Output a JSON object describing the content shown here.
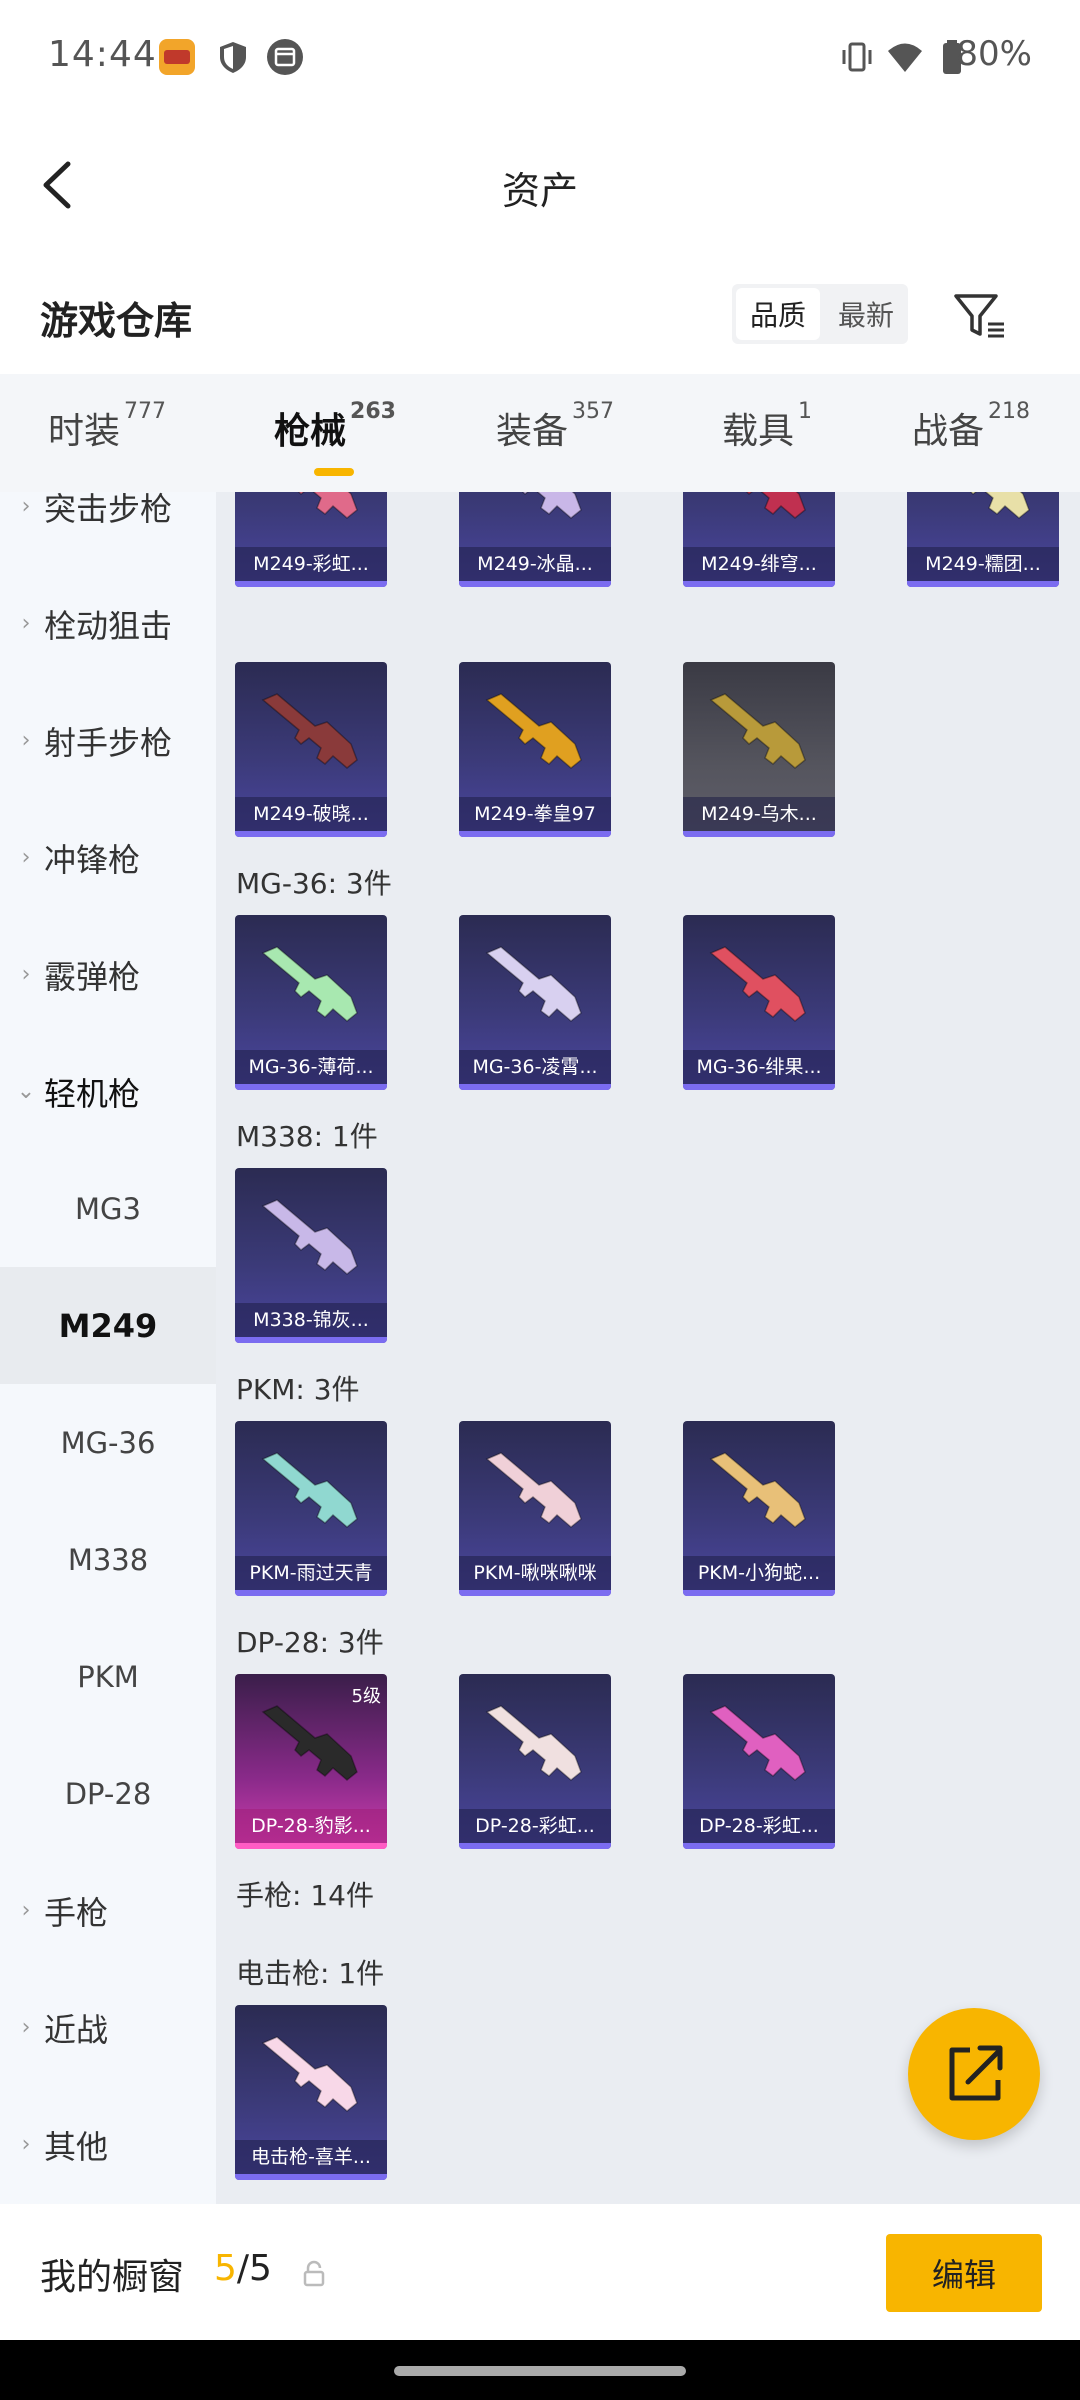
{
  "status_bar": {
    "time": "14:44",
    "battery": "80%",
    "icons": [
      "game-app-icon",
      "shield-icon",
      "calendar-icon",
      "vibrate-icon",
      "wifi-icon",
      "battery-icon"
    ]
  },
  "header": {
    "title": "资产"
  },
  "warehouse": {
    "title": "游戏仓库",
    "sort_options": [
      {
        "label": "品质",
        "active": true
      },
      {
        "label": "最新",
        "active": false
      }
    ]
  },
  "tabs": [
    {
      "label": "时装",
      "count": "777",
      "active": false
    },
    {
      "label": "枪械",
      "count": "263",
      "active": true
    },
    {
      "label": "装备",
      "count": "357",
      "active": false
    },
    {
      "label": "载具",
      "count": "1",
      "active": false
    },
    {
      "label": "战备",
      "count": "218",
      "active": false
    }
  ],
  "sidebar": {
    "items": [
      {
        "label": "突击步枪",
        "type": "category"
      },
      {
        "label": "栓动狙击",
        "type": "category"
      },
      {
        "label": "射手步枪",
        "type": "category"
      },
      {
        "label": "冲锋枪",
        "type": "category"
      },
      {
        "label": "霰弹枪",
        "type": "category"
      },
      {
        "label": "轻机枪",
        "type": "category-expanded"
      },
      {
        "label": "MG3",
        "type": "sub"
      },
      {
        "label": "M249",
        "type": "sub-active"
      },
      {
        "label": "MG-36",
        "type": "sub"
      },
      {
        "label": "M338",
        "type": "sub"
      },
      {
        "label": "PKM",
        "type": "sub"
      },
      {
        "label": "DP-28",
        "type": "sub"
      },
      {
        "label": "手枪",
        "type": "category"
      },
      {
        "label": "近战",
        "type": "category"
      },
      {
        "label": "其他",
        "type": "category"
      }
    ]
  },
  "content": {
    "groups": [
      {
        "label": "MG-36: 3件"
      },
      {
        "label": "M338: 1件"
      },
      {
        "label": "PKM: 3件"
      },
      {
        "label": "DP-28: 3件"
      },
      {
        "label": "手枪: 14件"
      },
      {
        "label": "电击枪: 1件"
      }
    ],
    "cards": [
      {
        "caption": "M249-彩虹...",
        "style": "purple",
        "gun_color": "#e06a8a"
      },
      {
        "caption": "M249-冰晶...",
        "style": "purple",
        "gun_color": "#c9b7e8"
      },
      {
        "caption": "M249-绯穹...",
        "style": "purple",
        "gun_color": "#c03050"
      },
      {
        "caption": "M249-糯团...",
        "style": "purple",
        "gun_color": "#e8e0a8"
      },
      {
        "caption": "M249-破晓...",
        "style": "purple",
        "gun_color": "#8a3a3a"
      },
      {
        "caption": "M249-拳皇97",
        "style": "purple",
        "gun_color": "#e0a020"
      },
      {
        "caption": "M249-乌木...",
        "style": "gray",
        "gun_color": "#b89a3a"
      },
      {
        "caption": "MG-36-薄荷...",
        "style": "purple",
        "gun_color": "#a8e8b0"
      },
      {
        "caption": "MG-36-凌霄...",
        "style": "purple",
        "gun_color": "#d8d0f0"
      },
      {
        "caption": "MG-36-绯果...",
        "style": "purple",
        "gun_color": "#e05060"
      },
      {
        "caption": "M338-锦灰...",
        "style": "purple",
        "gun_color": "#c8b8e8"
      },
      {
        "caption": "PKM-雨过天青",
        "style": "purple",
        "gun_color": "#90d8d0"
      },
      {
        "caption": "PKM-啾咪啾咪",
        "style": "purple",
        "gun_color": "#f0d0d8"
      },
      {
        "caption": "PKM-小狗蛇...",
        "style": "purple",
        "gun_color": "#e8c078"
      },
      {
        "caption": "DP-28-豹影...",
        "style": "pink",
        "gun_color": "#2a2a2a",
        "level": "5级"
      },
      {
        "caption": "DP-28-彩虹...",
        "style": "purple",
        "gun_color": "#f0e0e0"
      },
      {
        "caption": "DP-28-彩虹...",
        "style": "purple",
        "gun_color": "#e060c0"
      },
      {
        "caption": "电击枪-喜羊...",
        "style": "purple",
        "gun_color": "#f8d8e8"
      }
    ]
  },
  "fab": {
    "icon": "share-external-icon"
  },
  "bottom_bar": {
    "label": "我的橱窗",
    "count_current": "5",
    "count_total": "/5",
    "edit_label": "编辑"
  }
}
